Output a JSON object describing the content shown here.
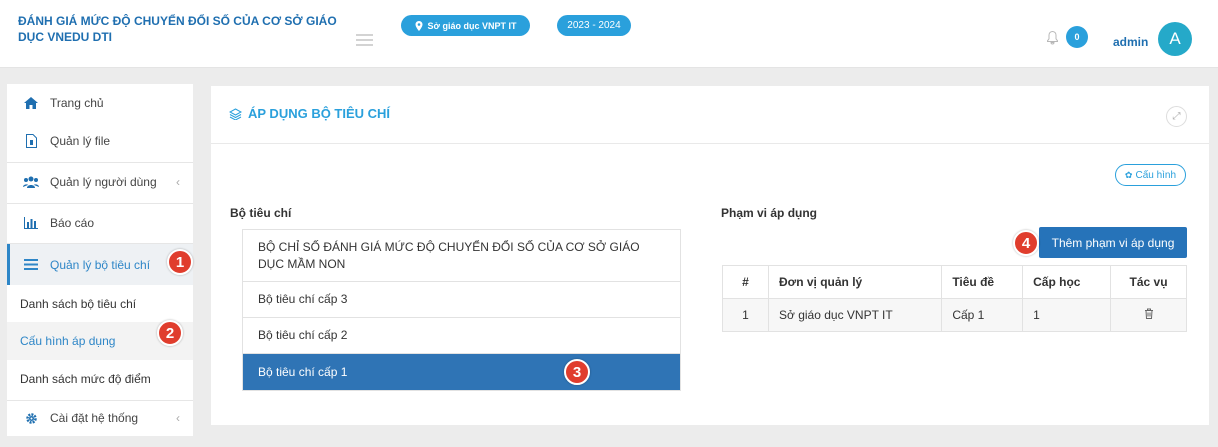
{
  "header": {
    "brand": "ĐÁNH GIÁ MỨC ĐỘ CHUYỂN ĐỔI SỐ CỦA CƠ SỞ GIÁO DỤC VNEDU DTI",
    "unit": "Sở giáo dục VNPT IT",
    "year": "2023 - 2024",
    "notifications": "0",
    "user": "admin",
    "avatar_letter": "A"
  },
  "sidebar": {
    "items": [
      {
        "label": "Trang chủ",
        "icon": "home-icon"
      },
      {
        "label": "Quản lý file",
        "icon": "file-icon"
      },
      {
        "label": "Quản lý người dùng",
        "icon": "users-icon",
        "chevron": "‹"
      },
      {
        "label": "Báo cáo",
        "icon": "bar-chart-icon"
      },
      {
        "label": "Quản lý bộ tiêu chí",
        "icon": "list-icon"
      },
      {
        "label": "Danh sách bộ tiêu chí"
      },
      {
        "label": "Cấu hình áp dụng"
      },
      {
        "label": "Danh sách mức độ điểm"
      },
      {
        "label": "Cài đặt hệ thống",
        "icon": "gear-icon",
        "chevron": "‹"
      }
    ]
  },
  "markers": [
    "1",
    "2",
    "3",
    "4"
  ],
  "panel": {
    "title": "ÁP DỤNG BỘ TIÊU CHÍ",
    "config_label": "Cấu hình",
    "criteria_label": "Bộ tiêu chí",
    "criteria": [
      "BỘ CHỈ SỐ ĐÁNH GIÁ MỨC ĐỘ CHUYỂN ĐỔI SỐ CỦA CƠ SỞ GIÁO DỤC MẦM NON",
      "Bộ tiêu chí cấp 3",
      "Bộ tiêu chí cấp 2",
      "Bộ tiêu chí cấp 1"
    ],
    "scope_label": "Phạm vi áp dụng",
    "add_scope_label": "Thêm phạm vi áp dụng",
    "table": {
      "headers": [
        "#",
        "Đơn vị quản lý",
        "Tiêu đề",
        "Cấp học",
        "Tác vụ"
      ],
      "rows": [
        [
          "1",
          "Sở giáo dục VNPT IT",
          "Cấp 1",
          "1"
        ]
      ]
    }
  },
  "colors": {
    "accent": "#2aa0dc",
    "primary": "#2f74b5",
    "marker": "#e03d2d"
  }
}
